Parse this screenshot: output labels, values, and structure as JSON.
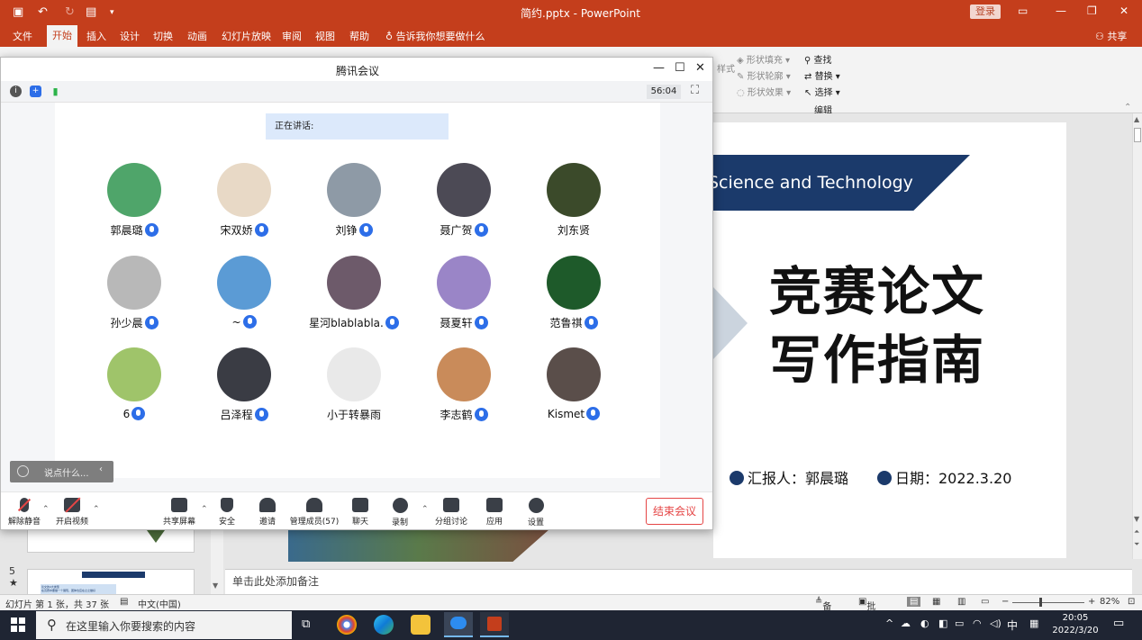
{
  "ppt": {
    "doc_title": "简约.pptx",
    "app_name": "PowerPoint",
    "login": "登录",
    "tabs": [
      "文件",
      "开始",
      "插入",
      "设计",
      "切换",
      "动画",
      "幻灯片放映",
      "审阅",
      "视图",
      "帮助"
    ],
    "active_tab": "开始",
    "tell_me": "告诉我你想要做什么",
    "share": "共享",
    "ribbon": {
      "shape_fill": "形状填充",
      "shape_outline": "形状轮廓",
      "shape_effect": "形状效果",
      "style": "样式",
      "find": "查找",
      "replace": "替换",
      "select": "选择",
      "editing": "编辑"
    },
    "slide": {
      "banner": "Science and Technology",
      "title_line1": "竞赛论文",
      "title_line2": "写作指南",
      "reporter": "汇报人：郭晨璐",
      "date": "日期：2022.3.20"
    },
    "thumb_number": "5",
    "thumb_star": "★",
    "thumb_b_lines": [
      "论文的4大类型",
      "在竞赛中要做一个展现，团体也应在之之做好"
    ],
    "notes_placeholder": "单击此处添加备注",
    "status": {
      "slide_info": "幻灯片 第 1 张，共 37 张",
      "language": "中文(中国)",
      "notes": "备注",
      "comments": "批注",
      "zoom": "82%"
    }
  },
  "meeting": {
    "title": "腾讯会议",
    "timer": "56:04",
    "speaking_label": "正在讲话:",
    "participants": [
      {
        "name": "郭晨璐",
        "mic": true,
        "color": "#4fa56a"
      },
      {
        "name": "宋双娇",
        "mic": true,
        "color": "#e8d9c6"
      },
      {
        "name": "刘铮",
        "mic": true,
        "color": "#8e9aa6"
      },
      {
        "name": "聂广贺",
        "mic": true,
        "color": "#4c4a55"
      },
      {
        "name": "刘东贤",
        "mic": false,
        "color": "#3b4a2a"
      },
      {
        "name": "孙少晨",
        "mic": true,
        "color": "#b8b8b8"
      },
      {
        "name": "~",
        "mic": true,
        "color": "#5b9bd5"
      },
      {
        "name": "星河blablabla.",
        "mic": true,
        "color": "#6d5a6a"
      },
      {
        "name": "聂夏轩",
        "mic": true,
        "color": "#9a85c7"
      },
      {
        "name": "范鲁祺",
        "mic": true,
        "color": "#1e5a2a"
      },
      {
        "name": "6",
        "mic": true,
        "color": "#9fc46a"
      },
      {
        "name": "吕泽程",
        "mic": true,
        "color": "#3a3c44"
      },
      {
        "name": "小于转暴雨",
        "mic": false,
        "color": "#e9e9e9"
      },
      {
        "name": "李志鹤",
        "mic": true,
        "color": "#c98b5a"
      },
      {
        "name": "Kismet",
        "mic": true,
        "color": "#5a4e4a"
      }
    ],
    "chat_placeholder": "说点什么...",
    "controls": {
      "unmute": "解除静音",
      "start_video": "开启视频",
      "share_screen": "共享屏幕",
      "security": "安全",
      "invite": "邀请",
      "manage_members": "管理成员(57)",
      "chat": "聊天",
      "record": "录制",
      "breakout": "分组讨论",
      "apps": "应用",
      "settings": "设置",
      "end_meeting": "结束会议"
    }
  },
  "taskbar": {
    "search_placeholder": "在这里输入你要搜索的内容",
    "ime": "中",
    "time": "20:05",
    "date": "2022/3/20"
  }
}
